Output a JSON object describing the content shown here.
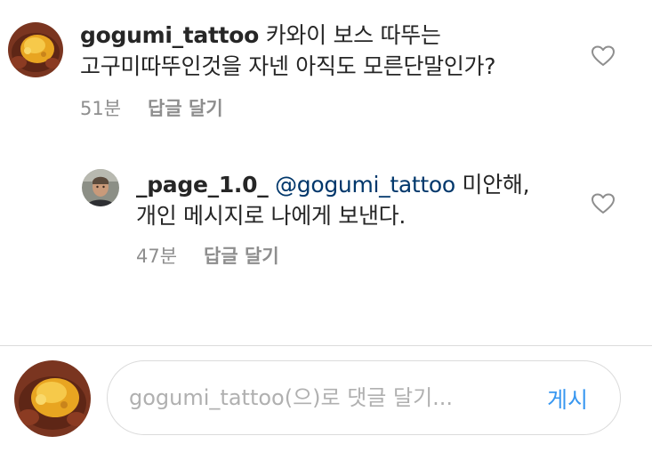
{
  "comments": [
    {
      "username": "gogumi_tattoo",
      "text_line1": " 카와이 보스 따뚜는",
      "text_line2": "고구미따뚜인것을 자넨 아직도 모른단말인가?",
      "time": "51분",
      "reply_label": "답글 달기",
      "avatar_icon": "sweet-potato-avatar",
      "like_icon": "heart-outline-icon"
    },
    {
      "username": "_page_1.0_",
      "mention": "@gogumi_tattoo",
      "text_line1": " 미안해,",
      "text_line2": "개인 메시지로 나에게 보낸다.",
      "time": "47분",
      "reply_label": "답글 달기",
      "avatar_icon": "person-avatar",
      "like_icon": "heart-outline-icon"
    }
  ],
  "composer": {
    "placeholder": "gogumi_tattoo(으)로 댓글 달기...",
    "post_label": "게시",
    "avatar_icon": "sweet-potato-avatar"
  },
  "colors": {
    "text": "#262626",
    "secondary": "#8e8e8e",
    "mention": "#00376b",
    "accent": "#3897f0",
    "divider": "#dbdbdb"
  }
}
